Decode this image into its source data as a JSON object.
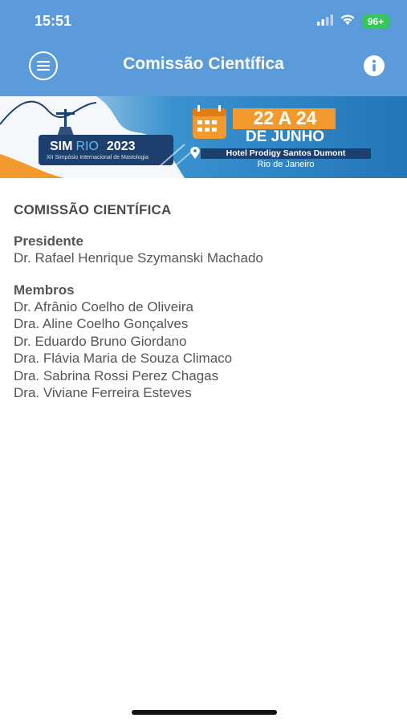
{
  "status_bar": {
    "time": "15:51",
    "battery": "96+",
    "icons": [
      "cellular-signal-icon",
      "wifi-icon",
      "battery-icon"
    ]
  },
  "nav": {
    "title": "Comissão Científica",
    "menu_icon": "hamburger-menu-icon",
    "info_icon": "info-icon"
  },
  "banner": {
    "logo_sim": "SIM",
    "logo_rio": "RIO",
    "logo_year": "2023",
    "logo_subtitle": "XII Simpósio Internacional de Mastologia",
    "dates": "22 A 24",
    "month": "DE JUNHO",
    "venue": "Hotel Prodigy Santos Dumont",
    "city": "Rio de Janeiro",
    "icons": [
      "calendar-icon",
      "location-pin-icon",
      "christ-the-redeemer-icon"
    ]
  },
  "content": {
    "title": "COMISSÃO CIENTÍFICA",
    "president_label": "Presidente",
    "president": "Dr. Rafael Henrique Szymanski Machado",
    "members_label": "Membros",
    "members": [
      "Dr. Afrânio Coelho de Oliveira",
      "Dra. Aline Coelho Gonçalves",
      "Dr. Eduardo Bruno Giordano",
      "Dra. Flávia Maria de Souza Climaco",
      "Dra. Sabrina Rossi Perez Chagas",
      "Dra. Viviane Ferreira Esteves"
    ]
  },
  "colors": {
    "header": "#5b9bd9",
    "banner_blue": "#2a86c4",
    "banner_orange": "#f29a2e",
    "banner_navy": "#1c3f6e",
    "text": "#555555"
  }
}
